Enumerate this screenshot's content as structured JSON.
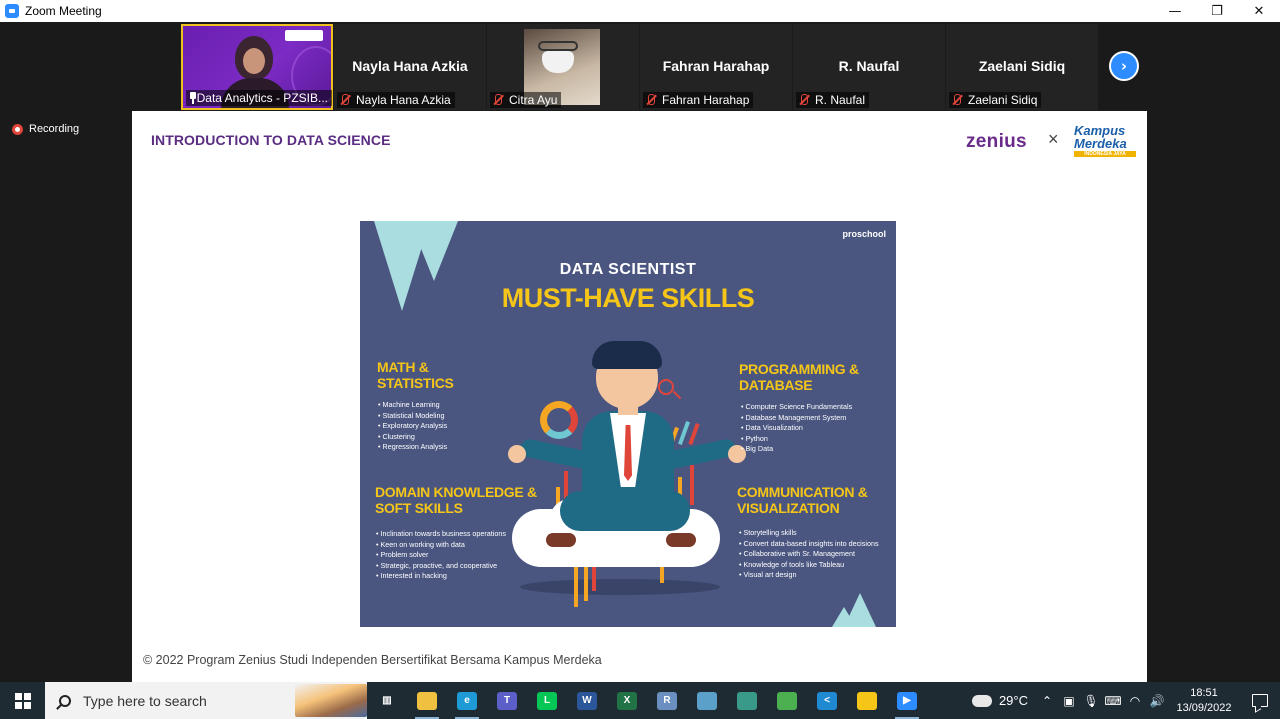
{
  "window": {
    "title": "Zoom Meeting",
    "controls": {
      "minimize": "—",
      "restore": "❐",
      "close": "✕"
    }
  },
  "participants": [
    {
      "name": "Data Analytics - PZSIB...",
      "display": "",
      "video": true,
      "pinned": true,
      "active": true
    },
    {
      "name": "Nayla Hana Azkia",
      "display": "Nayla Hana Azkia",
      "video": false,
      "muted": true
    },
    {
      "name": "Citra Ayu",
      "display": "",
      "video": true,
      "muted": true
    },
    {
      "name": "Fahran Harahap",
      "display": "Fahran Harahap",
      "video": false,
      "muted": true
    },
    {
      "name": "R. Naufal",
      "display": "R. Naufal",
      "video": false,
      "muted": true
    },
    {
      "name": "Zaelani Sidiq",
      "display": "Zaelani Sidiq",
      "video": false,
      "muted": true
    }
  ],
  "next_button": "›",
  "recording": {
    "label": "Recording"
  },
  "slide": {
    "title": "INTRODUCTION TO DATA SCIENCE",
    "brand_zenius": "zenius",
    "brand_x": "×",
    "brand_km_line1": "Kampus",
    "brand_km_line2": "Merdeka",
    "brand_km_sub": "INDONESIA JAYA",
    "footer": "© 2022 Program Zenius Studi Independen Bersertifikat Bersama Kampus Merdeka",
    "poster": {
      "brand": "proschool",
      "heading": "DATA SCIENTIST",
      "subheading": "MUST-HAVE SKILLS",
      "sections": [
        {
          "title_1": "MATH &",
          "title_2": "STATISTICS",
          "items": [
            "Machine Learning",
            "Statistical Modeling",
            "Exploratory Analysis",
            "Clustering",
            "Regression Analysis"
          ]
        },
        {
          "title_1": "PROGRAMMING &",
          "title_2": "DATABASE",
          "items": [
            "Computer Science Fundamentals",
            "Database Management System",
            "Data Visualization",
            "Python",
            "Big Data"
          ]
        },
        {
          "title_1": "DOMAIN KNOWLEDGE &",
          "title_2": "SOFT SKILLS",
          "items": [
            "Inclination towards business operations",
            "Keen on working with data",
            "Problem solver",
            "Strategic, proactive, and cooperative",
            "Interested in hacking"
          ]
        },
        {
          "title_1": "COMMUNICATION &",
          "title_2": "VISUALIZATION",
          "items": [
            "Storytelling skills",
            "Convert data-based insights into decisions",
            "Collaborative with Sr. Management",
            "Knowledge of tools like Tableau",
            "Visual art design"
          ]
        }
      ]
    }
  },
  "taskbar": {
    "search_placeholder": "Type here to search",
    "apps": [
      {
        "name": "task-view",
        "glyph": "▥",
        "color": "#1f2b33"
      },
      {
        "name": "file-explorer",
        "glyph": "",
        "color": "#f0c040"
      },
      {
        "name": "edge",
        "glyph": "e",
        "color": "#1e9bd7"
      },
      {
        "name": "teams",
        "glyph": "T",
        "color": "#5b5fc7"
      },
      {
        "name": "line",
        "glyph": "L",
        "color": "#06c755"
      },
      {
        "name": "word",
        "glyph": "W",
        "color": "#2b579a"
      },
      {
        "name": "excel",
        "glyph": "X",
        "color": "#217346"
      },
      {
        "name": "r-lang",
        "glyph": "R",
        "color": "#6a8fc0"
      },
      {
        "name": "notes-app",
        "glyph": "",
        "color": "#5aa0c8"
      },
      {
        "name": "paint-app",
        "glyph": "",
        "color": "#3a9a8a"
      },
      {
        "name": "chart-app",
        "glyph": "",
        "color": "#4caf50"
      },
      {
        "name": "vscode",
        "glyph": "<",
        "color": "#1f8ad2"
      },
      {
        "name": "sticky-notes",
        "glyph": "",
        "color": "#f5c518"
      },
      {
        "name": "zoom",
        "glyph": "▶",
        "color": "#2d8cff"
      }
    ],
    "weather": "29°C",
    "time": "18:51",
    "date": "13/09/2022"
  }
}
